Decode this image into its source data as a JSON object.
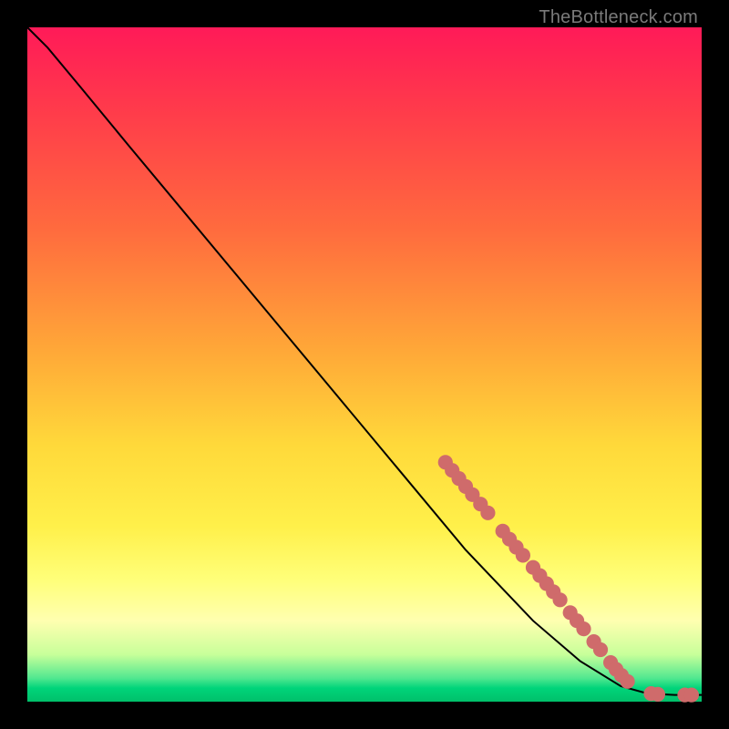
{
  "watermark": "TheBottleneck.com",
  "colors": {
    "dot": "#cf6b6b",
    "curve": "#000000",
    "frame": "#000000"
  },
  "chart_data": {
    "type": "line",
    "title": "",
    "xlabel": "",
    "ylabel": "",
    "xlim": [
      0,
      100
    ],
    "ylim": [
      0,
      100
    ],
    "grid": false,
    "legend": false,
    "curve_points": [
      {
        "x": 0,
        "y": 100
      },
      {
        "x": 3,
        "y": 97
      },
      {
        "x": 8,
        "y": 91
      },
      {
        "x": 15,
        "y": 82.5
      },
      {
        "x": 25,
        "y": 70.5
      },
      {
        "x": 35,
        "y": 58.5
      },
      {
        "x": 45,
        "y": 46.5
      },
      {
        "x": 55,
        "y": 34.5
      },
      {
        "x": 65,
        "y": 22.5
      },
      {
        "x": 75,
        "y": 12
      },
      {
        "x": 82,
        "y": 6
      },
      {
        "x": 88,
        "y": 2.3
      },
      {
        "x": 92,
        "y": 1.2
      },
      {
        "x": 96,
        "y": 1.0
      },
      {
        "x": 100,
        "y": 1.0
      }
    ],
    "dot_clusters": [
      {
        "x": 62.0,
        "y": 35.5,
        "r": 1.1
      },
      {
        "x": 63.0,
        "y": 34.3,
        "r": 1.1
      },
      {
        "x": 64.0,
        "y": 33.1,
        "r": 1.1
      },
      {
        "x": 65.0,
        "y": 31.9,
        "r": 1.1
      },
      {
        "x": 66.0,
        "y": 30.7,
        "r": 1.1
      },
      {
        "x": 67.2,
        "y": 29.3,
        "r": 1.1
      },
      {
        "x": 68.3,
        "y": 28.0,
        "r": 1.1
      },
      {
        "x": 70.5,
        "y": 25.3,
        "r": 1.1
      },
      {
        "x": 71.5,
        "y": 24.1,
        "r": 1.1
      },
      {
        "x": 72.5,
        "y": 22.9,
        "r": 1.1
      },
      {
        "x": 73.5,
        "y": 21.7,
        "r": 1.1
      },
      {
        "x": 75.0,
        "y": 19.9,
        "r": 1.1
      },
      {
        "x": 76.0,
        "y": 18.7,
        "r": 1.1
      },
      {
        "x": 77.0,
        "y": 17.5,
        "r": 1.1
      },
      {
        "x": 78.0,
        "y": 16.3,
        "r": 1.1
      },
      {
        "x": 79.0,
        "y": 15.1,
        "r": 1.1
      },
      {
        "x": 80.5,
        "y": 13.2,
        "r": 1.1
      },
      {
        "x": 81.5,
        "y": 12.0,
        "r": 1.1
      },
      {
        "x": 82.5,
        "y": 10.8,
        "r": 1.1
      },
      {
        "x": 84.0,
        "y": 8.9,
        "r": 1.1
      },
      {
        "x": 85.0,
        "y": 7.7,
        "r": 1.1
      },
      {
        "x": 86.5,
        "y": 5.8,
        "r": 1.1
      },
      {
        "x": 87.3,
        "y": 4.8,
        "r": 1.1
      },
      {
        "x": 88.1,
        "y": 3.9,
        "r": 1.1
      },
      {
        "x": 89.0,
        "y": 3.0,
        "r": 1.1
      },
      {
        "x": 92.5,
        "y": 1.2,
        "r": 1.1
      },
      {
        "x": 93.5,
        "y": 1.1,
        "r": 1.1
      },
      {
        "x": 97.5,
        "y": 1.0,
        "r": 1.1
      },
      {
        "x": 98.5,
        "y": 1.0,
        "r": 1.1
      }
    ]
  }
}
